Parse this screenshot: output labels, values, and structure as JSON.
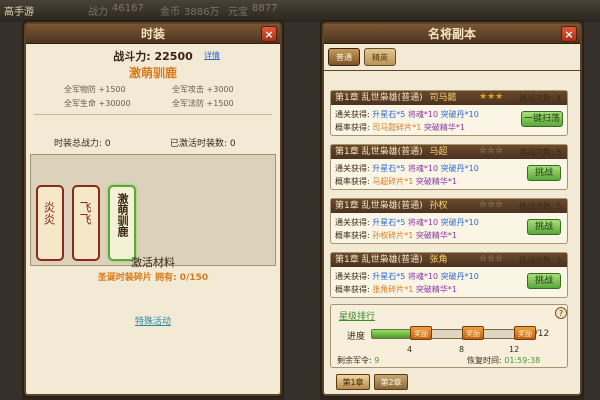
{
  "top_bar": {
    "left_label": "高手游",
    "stat1": "战力",
    "stat1_val": "46167",
    "stat2": "金币",
    "stat2_val": "3886万",
    "stat3": "元宝",
    "stat3_val": "8877"
  },
  "left_panel": {
    "title": "时装",
    "close": "×",
    "power_label": "战斗力: 22500",
    "detail_link": "详情",
    "costume_name": "激萌驯鹿",
    "stats": [
      {
        "label": "全军物防 +1500"
      },
      {
        "label": "全军攻击 +3000"
      },
      {
        "label": "全军生命 +30000"
      },
      {
        "label": "全军法防 +1500"
      }
    ],
    "total_power_label": "时装总战力: 0",
    "activated_label": "已激活时装数: 0",
    "costumes": [
      {
        "text": "炎炎",
        "color": "#8c2a1a"
      },
      {
        "text": "飞飞",
        "color": "#8c2a1a"
      },
      {
        "text": "激萌驯鹿",
        "color": "#5aa83a"
      }
    ],
    "material_title": "激活材料",
    "material_line": "圣诞时装碎片 拥有: 0/150",
    "special_link": "特殊活动"
  },
  "right_panel": {
    "title": "名将副本",
    "close": "×",
    "tab1": "普通",
    "tab2": "精英",
    "rows": [
      {
        "chapter": "第1章 乱世枭雄(普通)",
        "hero": "司马懿",
        "stars": 3,
        "challenge": "挑战次数: 4",
        "reward_label": "通关获得:",
        "reward_a": "升星石*5",
        "reward_b": "将魂*10",
        "reward_c": "突破丹*10",
        "prob_label": "概率获得:",
        "prob_a": "司马懿碎片*1",
        "prob_b": "突破精华*1",
        "button": "一键扫荡"
      },
      {
        "chapter": "第1章 乱世枭雄(普通)",
        "hero": "马超",
        "stars": 0,
        "challenge": "挑战次数: 5",
        "reward_label": "通关获得:",
        "reward_a": "升星石*5",
        "reward_b": "将魂*10",
        "reward_c": "突破丹*10",
        "prob_label": "概率获得:",
        "prob_a": "马超碎片*1",
        "prob_b": "突破精华*1",
        "button": "挑战"
      },
      {
        "chapter": "第1章 乱世枭雄(普通)",
        "hero": "孙权",
        "stars": 0,
        "challenge": "挑战次数: 5",
        "reward_label": "通关获得:",
        "reward_a": "升星石*5",
        "reward_b": "将魂*10",
        "reward_c": "突破丹*10",
        "prob_label": "概率获得:",
        "prob_a": "孙权碎片*1",
        "prob_b": "突破精华*1",
        "button": "挑战"
      },
      {
        "chapter": "第1章 乱世枭雄(普通)",
        "hero": "张角",
        "stars": 0,
        "challenge": "挑战次数: 5",
        "reward_label": "通关获得:",
        "reward_a": "升星石*5",
        "reward_b": "将魂*10",
        "reward_c": "突破丹*10",
        "prob_label": "概率获得:",
        "prob_a": "张角碎片*1",
        "prob_b": "突破精华*1",
        "button": "挑战"
      }
    ],
    "star_rank": "星级排行",
    "reward_btn": "奖励",
    "progress_label": "进度",
    "progress_text": "3/12",
    "progress_fraction": 0.25,
    "milestones": [
      "4",
      "8",
      "12"
    ],
    "remaining_label": "剩余军令:",
    "remaining_val": "9",
    "recover_label": "恢复时间:",
    "recover_val": "01:59:38",
    "chapter_tab1": "第1章",
    "chapter_tab2": "第2章"
  }
}
